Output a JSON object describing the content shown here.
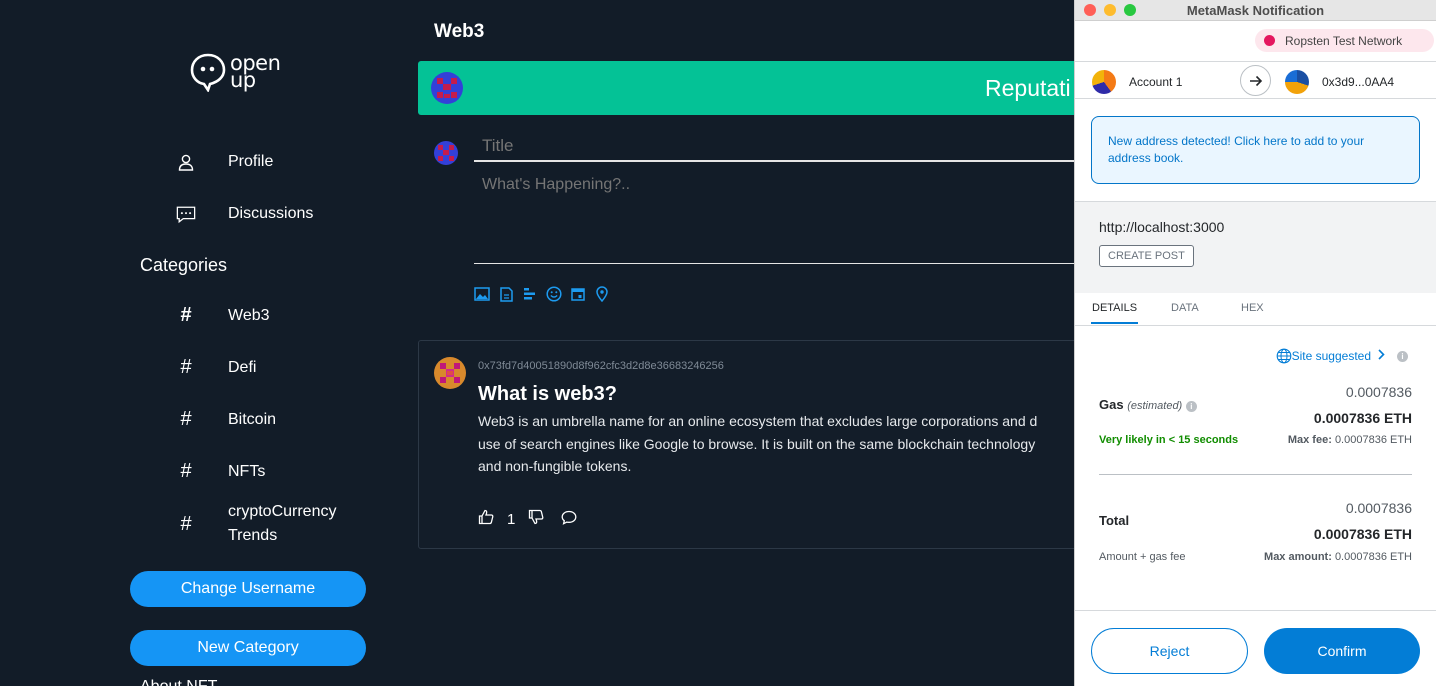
{
  "app": {
    "logo_text_line1": "open",
    "logo_text_line2": "up"
  },
  "sidebar": {
    "nav": [
      {
        "label": "Profile",
        "icon": "user-icon"
      },
      {
        "label": "Discussions",
        "icon": "chat-icon"
      }
    ],
    "categories_title": "Categories",
    "categories": [
      {
        "label": "Web3",
        "icon": "hash-icon"
      },
      {
        "label": "Defi",
        "icon": "hash-icon"
      },
      {
        "label": "Bitcoin",
        "icon": "hash-icon"
      },
      {
        "label": "NFTs",
        "icon": "hash-icon"
      },
      {
        "label": "cryptoCurrency\nTrends",
        "icon": "hash-icon"
      }
    ],
    "change_username_label": "Change Username",
    "new_category_label": "New Category",
    "cut_off_text": "About NFT"
  },
  "main": {
    "title": "Web3",
    "reputation_banner": "Reputati",
    "composer": {
      "title_placeholder": "Title",
      "body_placeholder": "What's Happening?..",
      "toolbar_icons": [
        "image-icon",
        "file-icon",
        "align-icon",
        "emoji-icon",
        "calendar-icon",
        "location-icon"
      ]
    },
    "post": {
      "address": "0x73fd7d40051890d8f962cfc3d2d8e36683246256",
      "title": "What is web3?",
      "body": "Web3 is an umbrella name for an online ecosystem that excludes large corporations and d\nuse of search engines like Google to browse. It is built on the same blockchain technology\nand non-fungible tokens.",
      "likes": "1"
    }
  },
  "metamask": {
    "window_title": "MetaMask Notification",
    "network": "Ropsten Test Network",
    "from_account": "Account 1",
    "to_account": "0x3d9...0AA4",
    "alert": "New address detected! Click here to add to your address book.",
    "origin": "http://localhost:3000",
    "action_tag": "CREATE POST",
    "tabs": [
      "DETAILS",
      "DATA",
      "HEX"
    ],
    "site_suggested": "Site suggested",
    "gas": {
      "label": "Gas",
      "estimated": "(estimated)",
      "value_small": "0.0007836",
      "value_bold": "0.0007836 ETH",
      "likely": "Very likely in < 15 seconds",
      "max_fee_label": "Max fee:",
      "max_fee_value": "0.0007836 ETH"
    },
    "total": {
      "label": "Total",
      "value_small": "0.0007836",
      "value_bold": "0.0007836 ETH",
      "sub_label": "Amount + gas fee",
      "max_amount_label": "Max amount:",
      "max_amount_value": "0.0007836 ETH"
    },
    "reject_label": "Reject",
    "confirm_label": "Confirm"
  },
  "colors": {
    "background": "#121c28",
    "accent_blue": "#1595f5",
    "reputation_green": "#04c296",
    "metamask_blue": "#037dd6",
    "success_green": "#118d00"
  }
}
